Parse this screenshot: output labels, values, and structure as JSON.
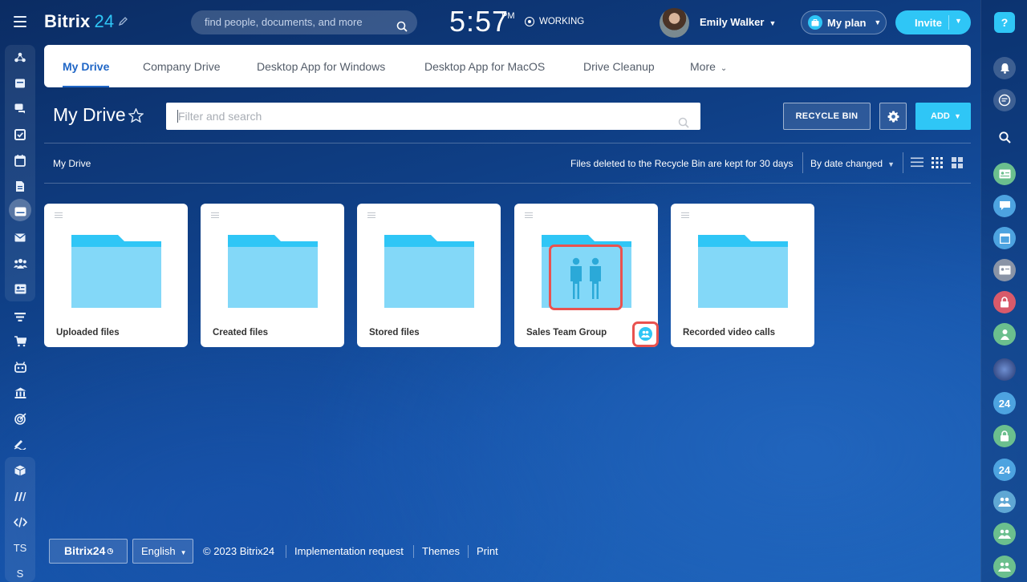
{
  "header": {
    "logo_text": "Bitrix",
    "logo_number": "24",
    "search_placeholder": "find people, documents, and more",
    "time": "5:57",
    "time_suffix": "PM",
    "work_status": "WORKING",
    "user_name": "Emily Walker",
    "plan_label": "My plan",
    "invite_label": "Invite"
  },
  "tabs": [
    {
      "label": "My Drive",
      "active": true
    },
    {
      "label": "Company Drive"
    },
    {
      "label": "Desktop App for Windows"
    },
    {
      "label": "Desktop App for MacOS"
    },
    {
      "label": "Drive Cleanup"
    },
    {
      "label": "More"
    }
  ],
  "page": {
    "title": "My Drive",
    "filter_placeholder": "Filter and search",
    "recycle_bin_label": "RECYCLE BIN",
    "add_label": "ADD",
    "breadcrumb": "My Drive",
    "notice": "Files deleted to the Recycle Bin are kept for 30 days",
    "sort_label": "By date changed"
  },
  "folders": [
    {
      "name": "Uploaded files"
    },
    {
      "name": "Created files"
    },
    {
      "name": "Stored files"
    },
    {
      "name": "Sales Team Group",
      "shared": true
    },
    {
      "name": "Recorded video calls"
    }
  ],
  "left_sidebar": {
    "icons": [
      "feed-icon",
      "calendar-board-icon",
      "chat-icon",
      "tasks-icon",
      "calendar-icon",
      "documents-icon",
      "drive-icon",
      "mail-icon",
      "groups-icon",
      "contact-center-icon",
      "crm-icon",
      "shop-icon",
      "robot-icon",
      "onboarding-icon",
      "target-icon",
      "signature-icon",
      "inventory-icon",
      "automation-icon",
      "developer-icon"
    ],
    "text_items": [
      "TS",
      "S"
    ]
  },
  "right_sidebar": {
    "help_label": "?",
    "badge_24": "24"
  },
  "footer": {
    "brand": "Bitrix24",
    "language": "English",
    "copyright": "© 2023 Bitrix24",
    "links": [
      "Implementation request",
      "Themes",
      "Print"
    ]
  },
  "colors": {
    "accent": "#2fc6f6",
    "tab_active": "#1f66c6",
    "highlight": "#e9524f",
    "folder_front": "#83d8f8",
    "folder_back": "#2fc6f6"
  }
}
